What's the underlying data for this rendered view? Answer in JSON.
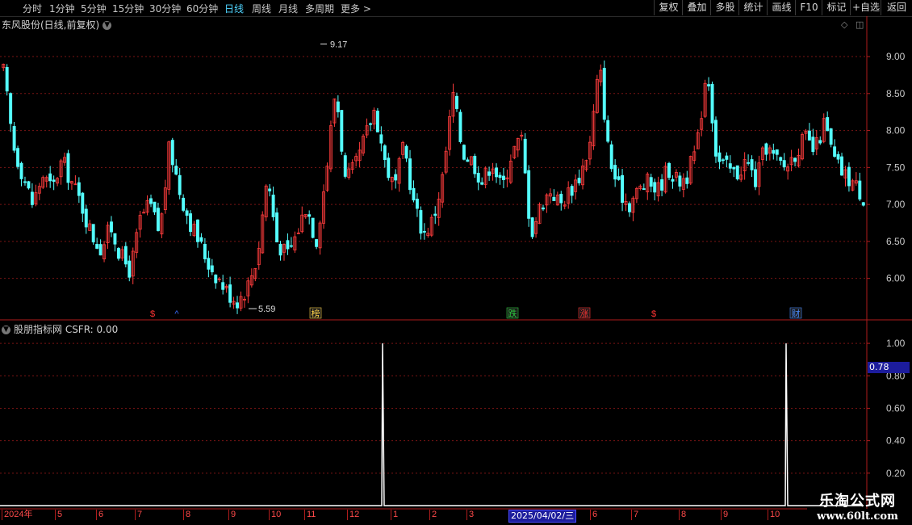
{
  "toolbar": {
    "periods": [
      "分时",
      "1分钟",
      "5分钟",
      "15分钟",
      "30分钟",
      "60分钟",
      "日线",
      "周线",
      "月线",
      "多周期",
      "更多 >"
    ],
    "active_period": "日线",
    "right_buttons": [
      "复权",
      "叠加",
      "多股",
      "统计",
      "画线",
      "F10",
      "标记",
      "+自选",
      "返回"
    ]
  },
  "main_chart": {
    "title": "东风股份(日线,前复权)",
    "high_label": "9.17",
    "low_label": "5.59",
    "price_ticks": [
      "9.00",
      "8.50",
      "8.00",
      "7.50",
      "7.00",
      "6.50",
      "6.00"
    ],
    "markers": [
      {
        "text": "$",
        "color": "#ff3333"
      },
      {
        "text": "^",
        "color": "#3a6cff"
      },
      {
        "text": "榜",
        "color": "#ffd24a"
      },
      {
        "text": "跌",
        "color": "#2ecc40"
      },
      {
        "text": "涨",
        "color": "#ff3333"
      },
      {
        "text": "$",
        "color": "#ff3333"
      },
      {
        "text": "财",
        "color": "#4a8cff"
      }
    ]
  },
  "indicator": {
    "title": "股朋指标网 CSFR: 0.00",
    "ticks": [
      "1.00",
      "0.80",
      "0.60",
      "0.40",
      "0.20"
    ],
    "cursor_value": "0.78"
  },
  "date_axis": {
    "labels": [
      "2024年",
      "5",
      "6",
      "7",
      "8",
      "9",
      "10",
      "11",
      "12",
      "1",
      "2",
      "3",
      "6",
      "7",
      "8",
      "9",
      "10"
    ],
    "cursor_date": "2025/04/02/三"
  },
  "watermark": {
    "line1": "乐淘公式网",
    "line2": "www.60lt.com"
  },
  "colors": {
    "up": "#ff3c3c",
    "down": "#54ffff",
    "grid": "#7a1414",
    "axis": "#b01c1c",
    "indicator_line": "#ffffff"
  },
  "chart_data": [
    {
      "type": "candlestick",
      "title": "东风股份(日线,前复权)",
      "ylim": [
        5.45,
        9.35
      ],
      "y_ticks": [
        9.0,
        8.5,
        8.0,
        7.5,
        7.0,
        6.5,
        6.0
      ],
      "annotations": [
        {
          "label": "9.17",
          "value": 9.17
        },
        {
          "label": "5.59",
          "value": 5.59
        }
      ],
      "close_path": [
        8.8,
        7.8,
        7.4,
        7.0,
        7.4,
        7.2,
        7.6,
        7.3,
        7.0,
        6.6,
        6.4,
        6.7,
        6.3,
        6.1,
        6.8,
        7.0,
        6.6,
        7.8,
        7.2,
        6.8,
        6.5,
        6.2,
        6.0,
        5.8,
        5.7,
        5.9,
        6.3,
        7.4,
        6.5,
        6.3,
        6.6,
        7.0,
        6.5,
        7.4,
        8.6,
        7.3,
        7.5,
        7.9,
        8.3,
        7.6,
        7.2,
        7.8,
        7.0,
        6.6,
        6.8,
        7.4,
        8.5,
        7.7,
        7.6,
        7.3,
        7.6,
        7.2,
        7.7,
        7.9,
        6.6,
        7.0,
        7.2,
        7.0,
        7.2,
        7.4,
        7.8,
        8.9,
        7.6,
        7.2,
        7.0,
        7.2,
        7.3,
        7.2,
        7.5,
        7.3,
        7.4,
        7.8,
        8.9,
        7.6,
        7.5,
        7.4,
        7.6,
        7.3,
        7.8,
        7.6,
        7.5,
        7.7,
        7.9,
        7.7,
        8.1,
        7.6,
        7.4,
        7.3,
        7.1
      ]
    },
    {
      "type": "line",
      "title": "股朋指标网 CSFR: 0.00",
      "ylim": [
        0,
        1.1
      ],
      "y_ticks": [
        1.0,
        0.8,
        0.6,
        0.4,
        0.2
      ],
      "values_description": "flat at 0.00 with two spikes to 1.00",
      "spikes": [
        1.0,
        1.0
      ],
      "baseline": 0.0
    }
  ]
}
